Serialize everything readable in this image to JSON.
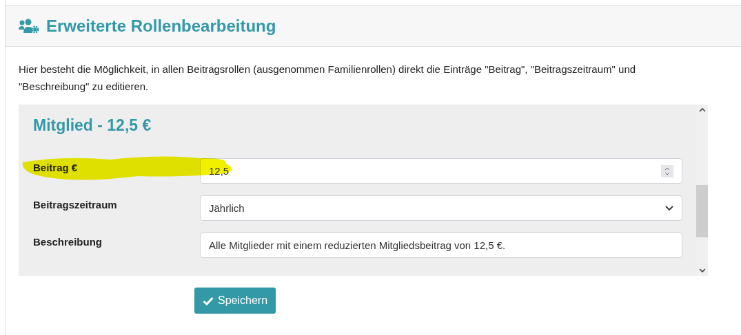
{
  "header": {
    "title": "Erweiterte Rollenbearbeitung"
  },
  "intro": "Hier besteht die Möglichkeit, in allen Beitragsrollen (ausgenommen Familienrollen) direkt die Einträge \"Beitrag\", \"Beitragszeitraum\" und \"Beschreibung\" zu editieren.",
  "role_panel": {
    "title": "Mitglied - 12,5 €",
    "fields": [
      {
        "kind": "number",
        "label": "Beitrag €",
        "value": "12,5",
        "highlighted": true
      },
      {
        "kind": "select",
        "label": "Beitragszeitraum",
        "value": "Jährlich",
        "highlighted": false
      },
      {
        "kind": "text",
        "label": "Beschreibung",
        "value": "Alle Mitglieder mit einem reduzierten Mitgliedsbeitrag von 12,5 €.",
        "highlighted": false
      }
    ]
  },
  "save_button": {
    "label": "Speichern"
  }
}
